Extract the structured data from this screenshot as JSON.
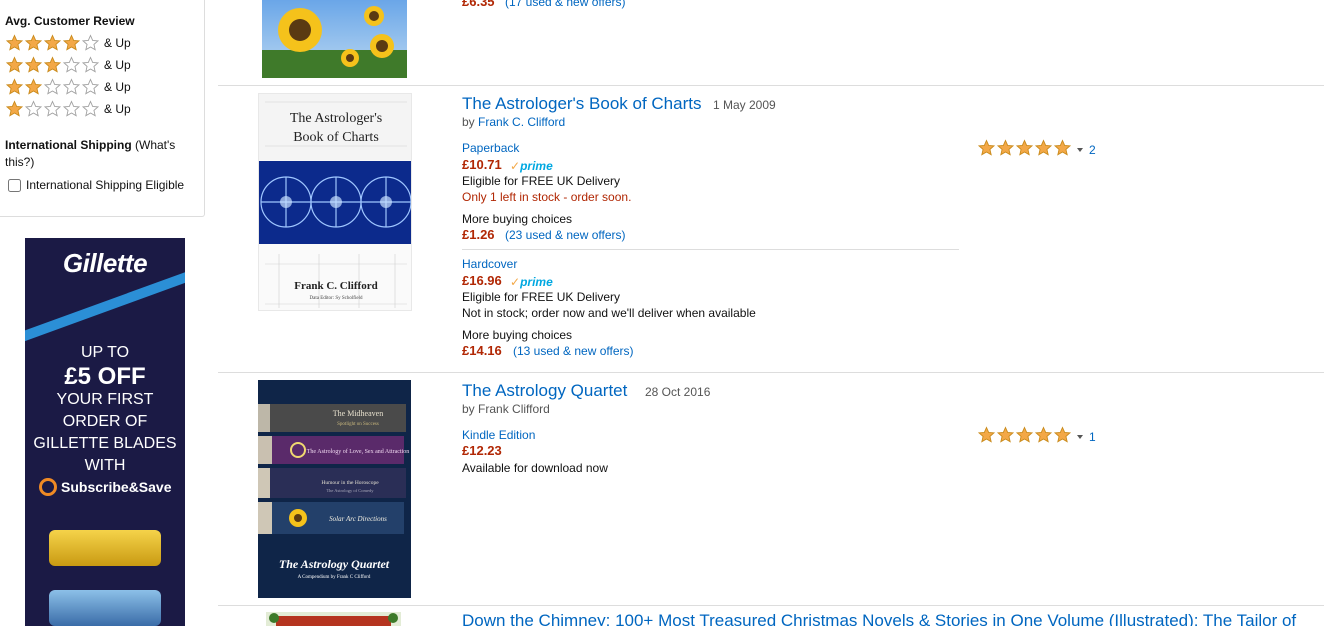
{
  "sidebar": {
    "review_heading": "Avg. Customer Review",
    "review_rows": [
      {
        "stars": 4,
        "label": "& Up"
      },
      {
        "stars": 3,
        "label": "& Up"
      },
      {
        "stars": 2,
        "label": "& Up"
      },
      {
        "stars": 1,
        "label": "& Up"
      }
    ],
    "shipping_heading": "International Shipping",
    "shipping_whats": "(What's this?)",
    "shipping_checkbox_label": "International Shipping Eligible"
  },
  "ad": {
    "brand": "Gillette",
    "lines": [
      "UP TO",
      "£5 OFF",
      "YOUR FIRST",
      "ORDER OF",
      "GILLETTE BLADES",
      "WITH"
    ],
    "subscribe": "Subscribe&Save"
  },
  "results": [
    {
      "partial_price": "£6.35",
      "partial_offers": "(17 used & new offers)"
    },
    {
      "title": "The Astrologer's Book of Charts",
      "date": "1 May 2009",
      "author_prefix": "by",
      "author": "Frank C. Clifford",
      "cover_text": {
        "line1": "The Astrologer's",
        "line2": "Book of Charts",
        "author": "Frank C. Clifford",
        "sub": "Data Editor: Sy Scholfield"
      },
      "rating": {
        "stars": 5,
        "count": "2"
      },
      "formats": [
        {
          "format": "Paperback",
          "price": "£10.71",
          "prime": "prime",
          "delivery": "Eligible for FREE UK Delivery",
          "stock": "Only 1 left in stock - order soon.",
          "more_label": "More buying choices",
          "more_price": "£1.26",
          "more_offers": "(23 used & new offers)"
        },
        {
          "format": "Hardcover",
          "price": "£16.96",
          "prime": "prime",
          "delivery": "Eligible for FREE UK Delivery",
          "stock": "Not in stock; order now and we'll deliver when available",
          "more_label": "More buying choices",
          "more_price": "£14.16",
          "more_offers": "(13 used & new offers)"
        }
      ]
    },
    {
      "title": "The Astrology Quartet",
      "date": "28 Oct 2016",
      "author_prefix": "by",
      "author": "Frank Clifford",
      "cover_text": {
        "b1": "The Midheaven",
        "b1s": "Spotlight on Success",
        "b2": "The Astrology of Love, Sex and Attraction",
        "b3": "Humour in the Horoscope",
        "b3s": "The Astrology of Comedy",
        "b4": "Solar Arc Directions",
        "title": "The Astrology Quartet",
        "sub": "A Compendium by Frank C Clifford"
      },
      "rating": {
        "stars": 5,
        "count": "1"
      },
      "formats": [
        {
          "format": "Kindle Edition",
          "price": "£12.23",
          "availability": "Available for download now"
        }
      ]
    },
    {
      "title": "Down the Chimney: 100+ Most Treasured Christmas Novels & Stories in One Volume (Illustrated): The Tailor of"
    }
  ],
  "colors": {
    "link": "#0066c0",
    "price": "#b12704",
    "star": "#f3a847",
    "prime": "#00a8e1"
  }
}
